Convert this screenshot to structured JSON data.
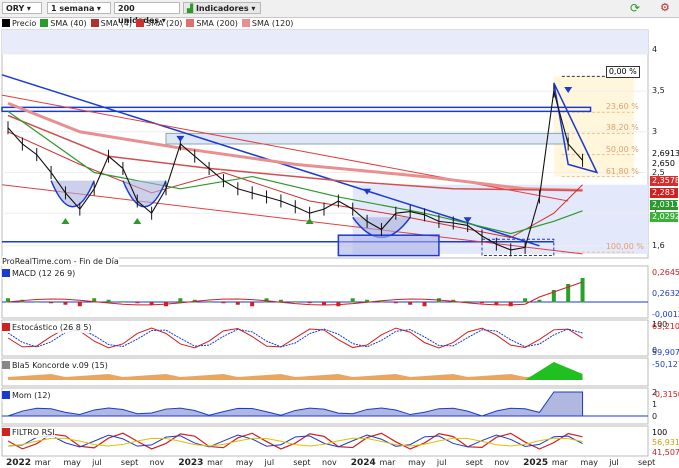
{
  "toolbar": {
    "symbol": "ORY",
    "period": "1 semana",
    "units": "200 unidades",
    "indicators": "Indicadores"
  },
  "legend": [
    {
      "label": "Precio",
      "color": "#000000"
    },
    {
      "label": "SMA (40)",
      "color": "#2a9a2a"
    },
    {
      "label": "SMA (4)",
      "color": "#b03030"
    },
    {
      "label": "SMA (20)",
      "color": "#d03030"
    },
    {
      "label": "SMA (200)",
      "color": "#e07070"
    },
    {
      "label": "SMA (120)",
      "color": "#e89090"
    }
  ],
  "source_text": "ProRealTime.com - Fin de Día",
  "colors": {
    "bullish": "#2aa02a",
    "bearish": "#d02020",
    "trend": "#1a3ad0",
    "fib": "#f0c080"
  },
  "chart_data": [
    {
      "type": "line",
      "panel": "price",
      "x_range": [
        "2022-01",
        "2025-09"
      ],
      "ylim": [
        1.45,
        4.25
      ],
      "y_ticks": [
        1.6,
        2,
        2.5,
        3,
        3.5,
        4
      ],
      "y_tick_labels": [
        "1,6",
        "2",
        "2,5",
        "3",
        "3,5",
        "4"
      ],
      "right_tags": [
        {
          "value": "2,6913",
          "color": "#000000",
          "bg": "#ffffff"
        },
        {
          "value": "2,650",
          "color": "#000000",
          "bg": "#ffffff"
        },
        {
          "value": "2,3578",
          "color": "#ffffff",
          "bg": "#d03030"
        },
        {
          "value": "2,283",
          "color": "#ffffff",
          "bg": "#d02020"
        },
        {
          "value": "2,0311",
          "color": "#ffffff",
          "bg": "#2a9a2a"
        },
        {
          "value": "2,0292",
          "color": "#ffffff",
          "bg": "#3ab03a"
        }
      ],
      "fib_levels": [
        {
          "label": "0,00 %",
          "value": 3.68
        },
        {
          "label": "23,60 %",
          "value": 3.24
        },
        {
          "label": "38,20 %",
          "value": 2.98
        },
        {
          "label": "50,00 %",
          "value": 2.72
        },
        {
          "label": "61,80 %",
          "value": 2.45
        },
        {
          "label": "100,00 %",
          "value": 1.52
        }
      ],
      "series_price": [
        {
          "x": "2022-01",
          "y": 3.05
        },
        {
          "x": "2022-02",
          "y": 2.85
        },
        {
          "x": "2022-03",
          "y": 2.72
        },
        {
          "x": "2022-04",
          "y": 2.5
        },
        {
          "x": "2022-05",
          "y": 2.25
        },
        {
          "x": "2022-06",
          "y": 2.05
        },
        {
          "x": "2022-07",
          "y": 2.3
        },
        {
          "x": "2022-08",
          "y": 2.7
        },
        {
          "x": "2022-09",
          "y": 2.55
        },
        {
          "x": "2022-10",
          "y": 2.15
        },
        {
          "x": "2022-11",
          "y": 2.0
        },
        {
          "x": "2022-12",
          "y": 2.3
        },
        {
          "x": "2023-01",
          "y": 2.85
        },
        {
          "x": "2023-02",
          "y": 2.7
        },
        {
          "x": "2023-03",
          "y": 2.55
        },
        {
          "x": "2023-04",
          "y": 2.4
        },
        {
          "x": "2023-05",
          "y": 2.3
        },
        {
          "x": "2023-06",
          "y": 2.25
        },
        {
          "x": "2023-07",
          "y": 2.2
        },
        {
          "x": "2023-08",
          "y": 2.15
        },
        {
          "x": "2023-09",
          "y": 2.08
        },
        {
          "x": "2023-10",
          "y": 2.0
        },
        {
          "x": "2023-11",
          "y": 2.05
        },
        {
          "x": "2023-12",
          "y": 2.15
        },
        {
          "x": "2024-01",
          "y": 2.05
        },
        {
          "x": "2024-02",
          "y": 1.9
        },
        {
          "x": "2024-03",
          "y": 1.8
        },
        {
          "x": "2024-04",
          "y": 2.0
        },
        {
          "x": "2024-05",
          "y": 2.02
        },
        {
          "x": "2024-06",
          "y": 1.98
        },
        {
          "x": "2024-07",
          "y": 1.9
        },
        {
          "x": "2024-08",
          "y": 1.88
        },
        {
          "x": "2024-09",
          "y": 1.85
        },
        {
          "x": "2024-10",
          "y": 1.72
        },
        {
          "x": "2024-11",
          "y": 1.62
        },
        {
          "x": "2024-12",
          "y": 1.55
        },
        {
          "x": "2025-01",
          "y": 1.58
        },
        {
          "x": "2025-02",
          "y": 2.2
        },
        {
          "x": "2025-03",
          "y": 3.5
        },
        {
          "x": "2025-04",
          "y": 2.85
        },
        {
          "x": "2025-05",
          "y": 2.65
        }
      ]
    },
    {
      "type": "bar",
      "panel": "macd",
      "title": "MACD (12 26 9)",
      "right_tags": [
        {
          "value": "0,2645",
          "color": "#d02020"
        },
        {
          "value": "0,2632",
          "color": "#1a3ad0"
        },
        {
          "value": "-0,0012",
          "color": "#1a3ad0"
        }
      ]
    },
    {
      "type": "line",
      "panel": "stochastic",
      "title": "Estocástico (26 8 5)",
      "y_ticks": [
        "100",
        "0"
      ],
      "right_tags": [
        {
          "value": "63,210",
          "color": "#d02020"
        },
        {
          "value": "59,907",
          "color": "#1a3ad0"
        }
      ]
    },
    {
      "type": "area",
      "panel": "koncorde",
      "title": "Bla5 Koncorde v.09 (15)",
      "right_tags": [
        {
          "value": "-50,127",
          "color": "#1a3ad0"
        }
      ]
    },
    {
      "type": "area",
      "panel": "momentum",
      "title": "Mom (12)",
      "y_ticks": [
        "2",
        "1",
        "0"
      ],
      "right_tags": [
        {
          "value": "-0,3150",
          "color": "#d02020"
        }
      ]
    },
    {
      "type": "line",
      "panel": "rsi",
      "title": "FILTRO RSI",
      "right_tags": [
        {
          "value": "100",
          "color": "#000000"
        },
        {
          "value": "56,931",
          "color": "#d0a000"
        },
        {
          "value": "41,507",
          "color": "#d02020"
        }
      ]
    }
  ],
  "x_axis_labels": [
    {
      "label": "2022",
      "date": "2022-01",
      "year": true
    },
    {
      "label": "mar",
      "date": "2022-03"
    },
    {
      "label": "may",
      "date": "2022-05"
    },
    {
      "label": "jul",
      "date": "2022-07"
    },
    {
      "label": "sept",
      "date": "2022-09"
    },
    {
      "label": "nov",
      "date": "2022-11"
    },
    {
      "label": "2023",
      "date": "2023-01",
      "year": true
    },
    {
      "label": "mar",
      "date": "2023-03"
    },
    {
      "label": "may",
      "date": "2023-05"
    },
    {
      "label": "jul",
      "date": "2023-07"
    },
    {
      "label": "sept",
      "date": "2023-09"
    },
    {
      "label": "nov",
      "date": "2023-11"
    },
    {
      "label": "2024",
      "date": "2024-01",
      "year": true
    },
    {
      "label": "mar",
      "date": "2024-03"
    },
    {
      "label": "may",
      "date": "2024-05"
    },
    {
      "label": "jul",
      "date": "2024-07"
    },
    {
      "label": "sept",
      "date": "2024-09"
    },
    {
      "label": "nov",
      "date": "2024-11"
    },
    {
      "label": "2025",
      "date": "2025-01",
      "year": true
    },
    {
      "label": "mar",
      "date": "2025-03"
    },
    {
      "label": "may",
      "date": "2025-05"
    },
    {
      "label": "jul",
      "date": "2025-07"
    },
    {
      "label": "sept",
      "date": "2025-09"
    }
  ]
}
